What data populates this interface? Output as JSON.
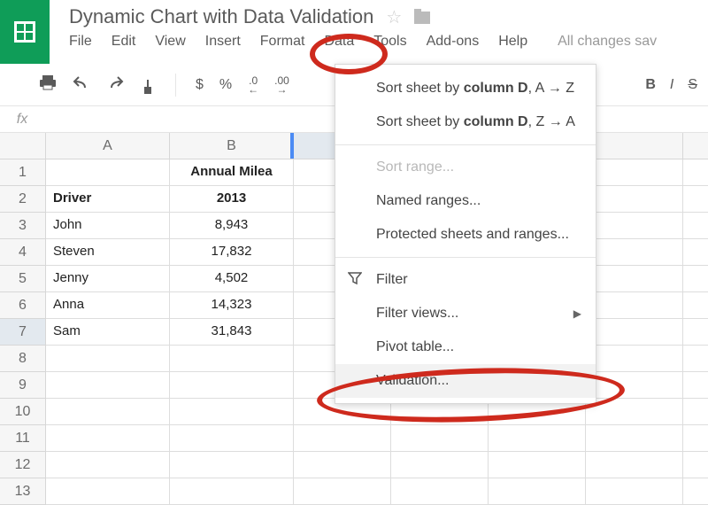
{
  "header": {
    "title": "Dynamic Chart with Data Validation",
    "saved_label": "All changes sav"
  },
  "menu": {
    "file": "File",
    "edit": "Edit",
    "view": "View",
    "insert": "Insert",
    "format": "Format",
    "data": "Data",
    "tools": "Tools",
    "addons": "Add-ons",
    "help": "Help"
  },
  "toolbar": {
    "currency": "$",
    "percent": "%",
    "dec_less_top": ".0",
    "dec_less_bottom": "←",
    "dec_more_top": ".00",
    "dec_more_bottom": "→",
    "bold": "B",
    "italic": "I",
    "strike": "S"
  },
  "dropdown": {
    "sort_a_pre": "Sort sheet by ",
    "sort_a_col": "column D",
    "sort_a_suf": ", A → Z",
    "sort_z_pre": "Sort sheet by ",
    "sort_z_col": "column D",
    "sort_z_suf": ", Z → A",
    "sort_range": "Sort range...",
    "named_ranges": "Named ranges...",
    "protected": "Protected sheets and ranges...",
    "filter": "Filter",
    "filter_views": "Filter views...",
    "pivot": "Pivot table...",
    "validation": "Validation..."
  },
  "cols": {
    "A": "A",
    "B": "B"
  },
  "sheet": {
    "r1": {
      "b": "Annual Milea"
    },
    "r2": {
      "a": "Driver",
      "b": "2013"
    },
    "r3": {
      "a": "John",
      "b": "8,943"
    },
    "r4": {
      "a": "Steven",
      "b": "17,832"
    },
    "r5": {
      "a": "Jenny",
      "b": "4,502"
    },
    "r6": {
      "a": "Anna",
      "b": "14,323"
    },
    "r7": {
      "a": "Sam",
      "b": "31,843"
    }
  },
  "rows": {
    "r1": "1",
    "r2": "2",
    "r3": "3",
    "r4": "4",
    "r5": "5",
    "r6": "6",
    "r7": "7",
    "r8": "8",
    "r9": "9",
    "r10": "10",
    "r11": "11",
    "r12": "12",
    "r13": "13"
  }
}
